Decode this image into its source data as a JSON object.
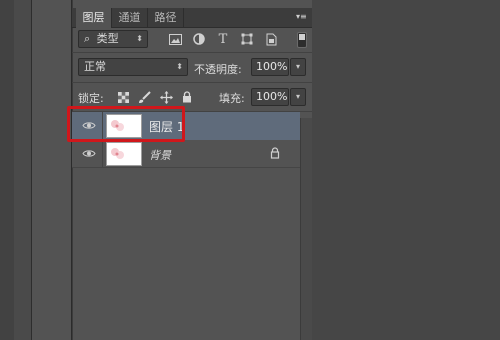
{
  "panel": {
    "tabs": [
      {
        "label": "图层",
        "active": true
      },
      {
        "label": "通道",
        "active": false
      },
      {
        "label": "路径",
        "active": false
      }
    ],
    "menu_icon": "panel-menu-icon"
  },
  "filter": {
    "kind_label": "类型",
    "icons": [
      "image-filter-icon",
      "adjustment-filter-icon",
      "type-filter-icon",
      "shape-filter-icon",
      "smart-object-filter-icon"
    ],
    "toggle_on": true
  },
  "blend": {
    "mode": "正常",
    "opacity_label": "不透明度:",
    "opacity_value": "100%"
  },
  "lock": {
    "label": "锁定:",
    "icons": [
      "lock-transparency-icon",
      "lock-paint-icon",
      "lock-position-icon",
      "lock-all-icon"
    ],
    "fill_label": "填充:",
    "fill_value": "100%"
  },
  "layers": [
    {
      "name": "图层 1",
      "visible": true,
      "selected": true,
      "locked": false
    },
    {
      "name": "背景",
      "visible": true,
      "selected": false,
      "locked": true
    }
  ],
  "colors": {
    "panel_bg": "#535353",
    "selected_row": "#5f6b7b",
    "highlight": "#d0171b"
  }
}
